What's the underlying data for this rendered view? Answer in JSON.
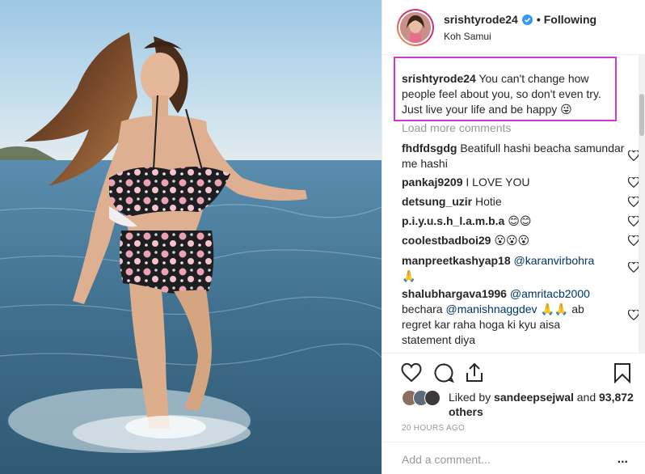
{
  "post": {
    "photo_label": "photo of woman in floral bikini walking in the sea",
    "header": {
      "username": "srishtyrode24",
      "verified_icon": "verified-badge-icon",
      "separator": "•",
      "follow_state": "Following",
      "location": "Koh Samui"
    },
    "caption": {
      "author": "srishtyrode24",
      "text": "You can't change how people feel about you, so don't even try. Just live your life and be happy 😜"
    },
    "load_more": "Load more comments",
    "comments": [
      {
        "author": "fhdfdsgdg",
        "text": "Beatifull hashi beacha samundar me hashi"
      },
      {
        "author": "pankaj9209",
        "text": "I LOVE YOU"
      },
      {
        "author": "detsung_uzir",
        "text": "Hotie"
      },
      {
        "author": "p.i.y.u.s.h_l.a.m.b.a",
        "text": "😊😊"
      },
      {
        "author": "coolestbadboi29",
        "text": "😮😮😮"
      },
      {
        "author": "manpreetkashyap18",
        "mention": "@karanvirbohra",
        "text": "🙏"
      },
      {
        "author": "shalubhargava1996",
        "mention": "@amritacb2000",
        "text_before": "bechara",
        "mention2": "@manishnaggdev",
        "text": "🙏🙏 ab regret kar raha hoga ki kyu aisa statement diya"
      }
    ],
    "actions": {
      "like_icon": "heart-icon",
      "comment_icon": "comment-bubble-icon",
      "share_icon": "share-icon",
      "save_icon": "bookmark-icon"
    },
    "likes": {
      "prefix": "Liked by",
      "by_user": "sandeepsejwal",
      "and": "and",
      "count": "93,872 others"
    },
    "timestamp": "20 HOURS AGO",
    "add_comment_placeholder": "Add a comment...",
    "more_options": "..."
  },
  "colors": {
    "highlight_border": "#d238d2",
    "text_primary": "#262626",
    "text_secondary": "#999999",
    "link": "#003569",
    "verified_blue": "#3897f0"
  }
}
